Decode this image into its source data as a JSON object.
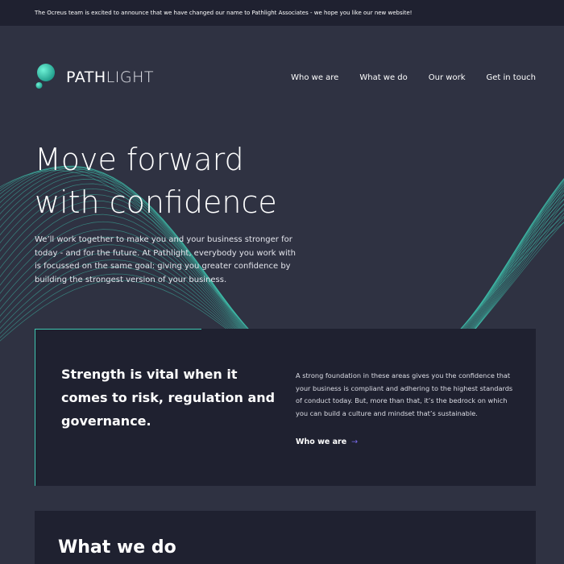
{
  "announcement": "The Ocreus team is excited to announce that we have changed our name to Pathlight Associates - we hope you like our new website!",
  "brand": {
    "name_bold": "PATH",
    "name_light": "LIGHT",
    "accent": "#3fc7b0"
  },
  "nav": [
    {
      "label": "Who we are"
    },
    {
      "label": "What we do"
    },
    {
      "label": "Our work"
    },
    {
      "label": "Get in touch"
    }
  ],
  "hero": {
    "title_line1": "Move forward",
    "title_line2": "with confidence",
    "text": "We’ll work together to make you and your business stronger for today - and for the future. At Pathlight, everybody you work with is focussed on the same goal: giving you greater confidence by building the strongest version of your business."
  },
  "feature": {
    "heading": "Strength is vital when it comes to risk, regulation and governance.",
    "body": "A strong foundation in these areas gives you the confidence that your business is compliant and adhering to the highest standards of conduct today. But, more than that, it’s the bedrock on which you can build a culture and mindset that’s sustainable.",
    "link_label": "Who we are",
    "link_arrow": "→"
  },
  "section2": {
    "heading": "What we do"
  },
  "colors": {
    "background": "#2f3242",
    "panel": "#1f2130",
    "accent": "#3fc7b0",
    "arrow": "#7b6cf0"
  }
}
